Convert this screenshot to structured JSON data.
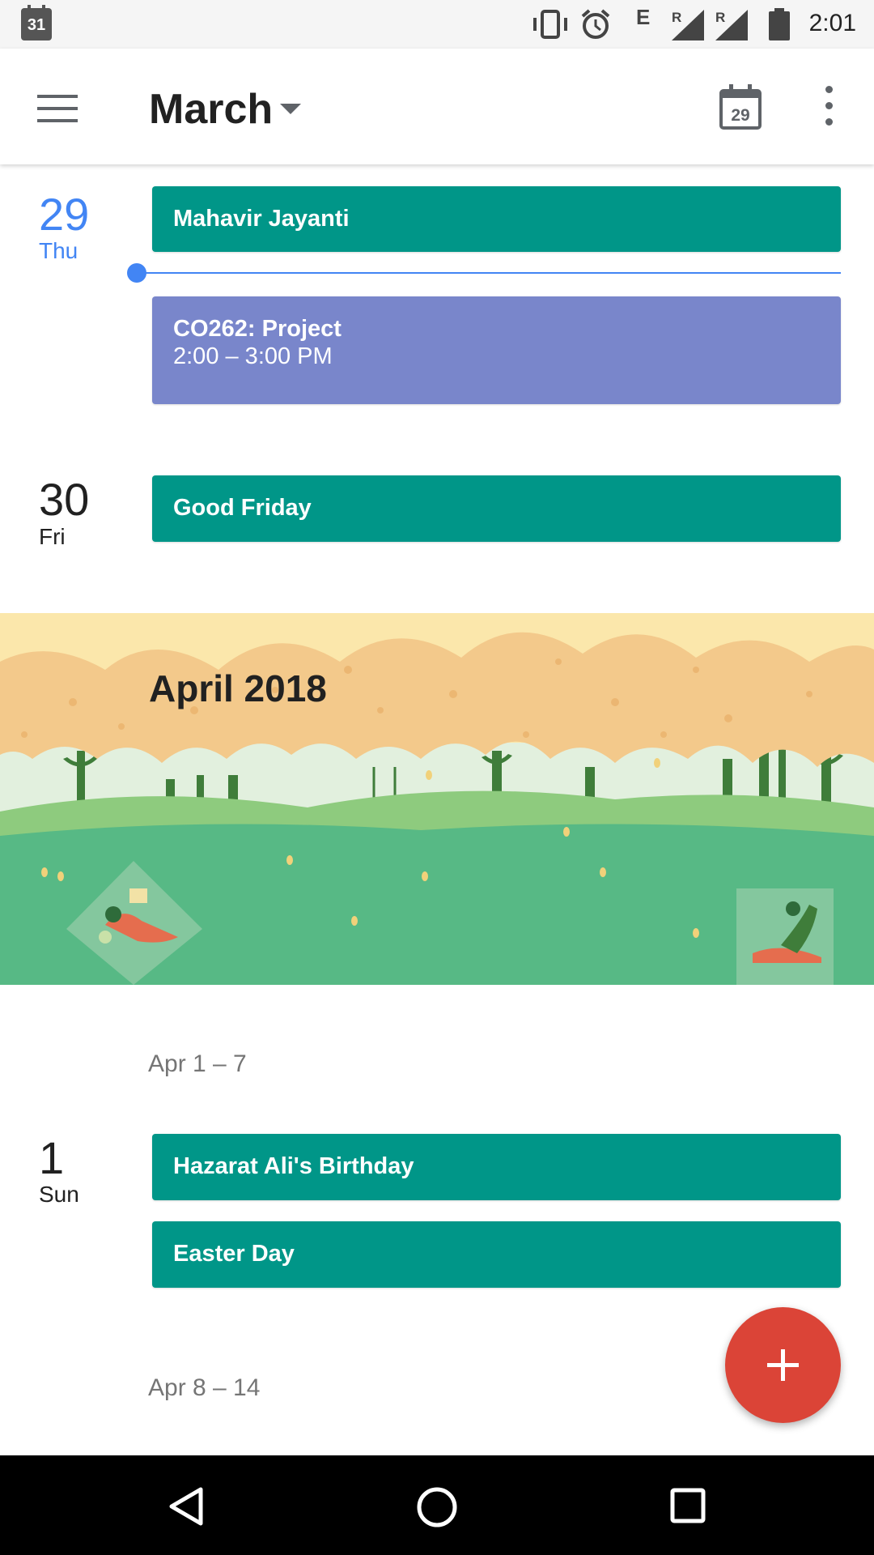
{
  "status_bar": {
    "calendar_notification_day": "31",
    "network_label": "E",
    "roaming_label_1": "R",
    "roaming_label_2": "R",
    "time": "2:01",
    "icons": [
      "calendar-notification-icon",
      "vibrate-icon",
      "alarm-icon",
      "signal-icon",
      "signal-icon",
      "battery-icon"
    ]
  },
  "app_bar": {
    "title": "March",
    "today_date": "29",
    "icons": [
      "hamburger-menu-icon",
      "dropdown-arrow-icon",
      "today-calendar-icon",
      "more-vert-icon"
    ]
  },
  "schedule": {
    "day_29": {
      "num": "29",
      "name": "Thu",
      "events": [
        {
          "title": "Mahavir Jayanti",
          "color": "#009688"
        },
        {
          "title": "CO262: Project",
          "time": "2:00 – 3:00 PM",
          "color": "#7986cb"
        }
      ]
    },
    "day_30": {
      "num": "30",
      "name": "Fri",
      "events": [
        {
          "title": "Good Friday",
          "color": "#009688"
        }
      ]
    },
    "month_banner": {
      "title": "April 2018"
    },
    "week_1": "Apr 1 – 7",
    "day_1": {
      "num": "1",
      "name": "Sun",
      "events": [
        {
          "title": "Hazarat Ali's Birthday",
          "color": "#009688"
        },
        {
          "title": "Easter Day",
          "color": "#009688"
        }
      ]
    },
    "week_2": "Apr 8 – 14"
  },
  "fab": {
    "icon": "plus-icon",
    "color": "#db4437"
  },
  "nav_bar": {
    "icons": [
      "back-icon",
      "home-icon",
      "recents-icon"
    ]
  },
  "colors": {
    "accent": "#4285f4",
    "holiday": "#009688",
    "event": "#7986cb"
  }
}
